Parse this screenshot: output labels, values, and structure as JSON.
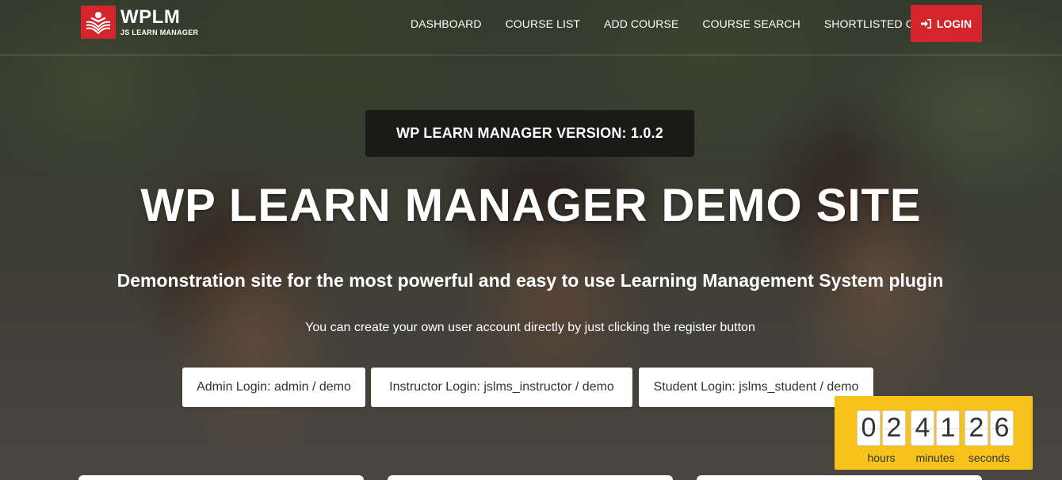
{
  "header": {
    "logo_title": "WPLM",
    "logo_subtitle": "JS LEARN MANAGER",
    "nav": [
      "DASHBOARD",
      "COURSE LIST",
      "ADD COURSE",
      "COURSE SEARCH",
      "SHORTLISTED COURSE"
    ],
    "login_label": "LOGIN"
  },
  "hero": {
    "version": "WP LEARN MANAGER VERSION: 1.0.2",
    "title": "WP LEARN MANAGER DEMO SITE",
    "subtitle": "Demonstration site for the most powerful and easy to use Learning Management System plugin",
    "note": "You can create your own user account directly by just clicking the register button",
    "credentials": {
      "admin": "Admin Login: admin / demo",
      "instructor": "Instructor Login: jslms_instructor / demo",
      "student": "Student Login: jslms_student / demo"
    }
  },
  "countdown": {
    "hours": [
      "0",
      "2"
    ],
    "minutes": [
      "4",
      "1"
    ],
    "seconds": [
      "2",
      "6"
    ],
    "labels": {
      "hours": "hours",
      "minutes": "minutes",
      "seconds": "seconds"
    }
  },
  "colors": {
    "brand_red": "#d4262a",
    "countdown_bg": "#f6c21b"
  },
  "icons": {
    "logo": "book-reader-icon",
    "login": "sign-in-icon"
  }
}
